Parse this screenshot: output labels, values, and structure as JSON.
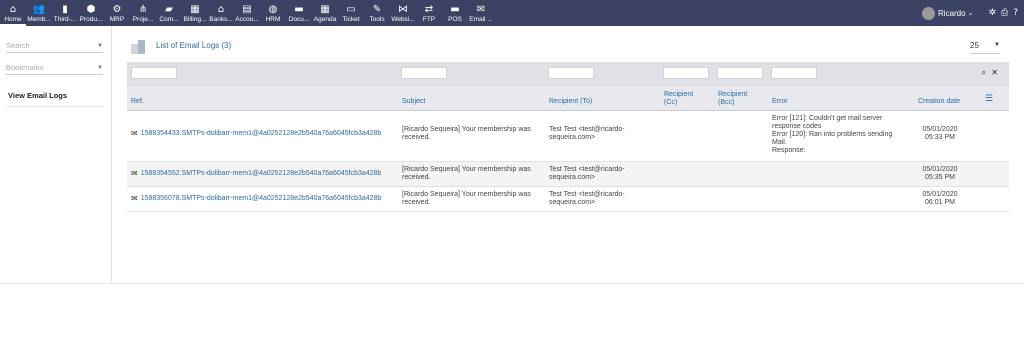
{
  "menu": [
    {
      "icon": "home-icon",
      "glyph": "⌂",
      "label": "Home",
      "active": true
    },
    {
      "icon": "members-icon",
      "glyph": "👥",
      "label": "Memb..."
    },
    {
      "icon": "thirdparty-icon",
      "glyph": "▮",
      "label": "Third-..."
    },
    {
      "icon": "products-icon",
      "glyph": "⬢",
      "label": "Produ..."
    },
    {
      "icon": "mrp-icon",
      "glyph": "⚙",
      "label": "MRP"
    },
    {
      "icon": "projects-icon",
      "glyph": "⋔",
      "label": "Proje..."
    },
    {
      "icon": "commercial-icon",
      "glyph": "▰",
      "label": "Com..."
    },
    {
      "icon": "billing-icon",
      "glyph": "▦",
      "label": "Billing..."
    },
    {
      "icon": "banks-icon",
      "glyph": "⌂",
      "label": "Banks..."
    },
    {
      "icon": "accounting-icon",
      "glyph": "▤",
      "label": "Accou..."
    },
    {
      "icon": "hrm-icon",
      "glyph": "◍",
      "label": "HRM"
    },
    {
      "icon": "documents-icon",
      "glyph": "▬",
      "label": "Docu..."
    },
    {
      "icon": "agenda-icon",
      "glyph": "▦",
      "label": "Agenda"
    },
    {
      "icon": "ticket-icon",
      "glyph": "▭",
      "label": "Ticket"
    },
    {
      "icon": "tools-icon",
      "glyph": "✎",
      "label": "Tools"
    },
    {
      "icon": "website-icon",
      "glyph": "⋈",
      "label": "Websi..."
    },
    {
      "icon": "ftp-icon",
      "glyph": "⇄",
      "label": "FTP"
    },
    {
      "icon": "pos-icon",
      "glyph": "▬",
      "label": "POS"
    },
    {
      "icon": "email-icon",
      "glyph": "✉",
      "label": "Email ..."
    }
  ],
  "user": {
    "name": "Ricardo",
    "chevron": "⌄"
  },
  "sidebar": {
    "search_placeholder": "Search",
    "bookmarks_label": "Bookmarks",
    "link": "View Email Logs"
  },
  "page": {
    "title": "List of Email Logs (3)",
    "page_size": "25"
  },
  "columns": {
    "ref": "Ref.",
    "subject": "Subject",
    "recipient_to": "Recipient (To)",
    "recipient_cc_1": "Recipient",
    "recipient_cc_2": "(Cc)",
    "recipient_bcc_1": "Recipient",
    "recipient_bcc_2": "(Bcc)",
    "error": "Error",
    "creation_date": "Creation date"
  },
  "rows": [
    {
      "ref": "1588354433.SMTPs-dolibarr-mem1@4a0252128e2b540a76a6045fcb3a428b",
      "subject_1": "[Ricardo Sequeira] Your membership was",
      "subject_2": "received.",
      "to_1": "Test Test <test@ricardo-",
      "to_2": "sequeira.com>",
      "error_1": "Error [121]: Couldn't get mail server",
      "error_2": "response codes",
      "error_3": "Error [120]: Ran into problems sending",
      "error_4": "Mail.",
      "error_5": "Response:",
      "date": "05/01/2020",
      "time": "05:33 PM"
    },
    {
      "ref": "1588354552.SMTPs-dolibarr-mem1@4a0252128e2b540a76a6045fcb3a428b",
      "subject_1": "[Ricardo Sequeira] Your membership was",
      "subject_2": "received.",
      "to_1": "Test Test <test@ricardo-",
      "to_2": "sequeira.com>",
      "date": "05/01/2020",
      "time": "05:35 PM"
    },
    {
      "ref": "1588356078.SMTPs-dolibarr-mem1@4a0252128e2b540a76a6045fcb3a428b",
      "subject_1": "[Ricardo Sequeira] Your membership was",
      "subject_2": "received.",
      "to_1": "Test Test <test@ricardo-",
      "to_2": "sequeira.com>",
      "date": "05/01/2020",
      "time": "06:01 PM"
    }
  ]
}
